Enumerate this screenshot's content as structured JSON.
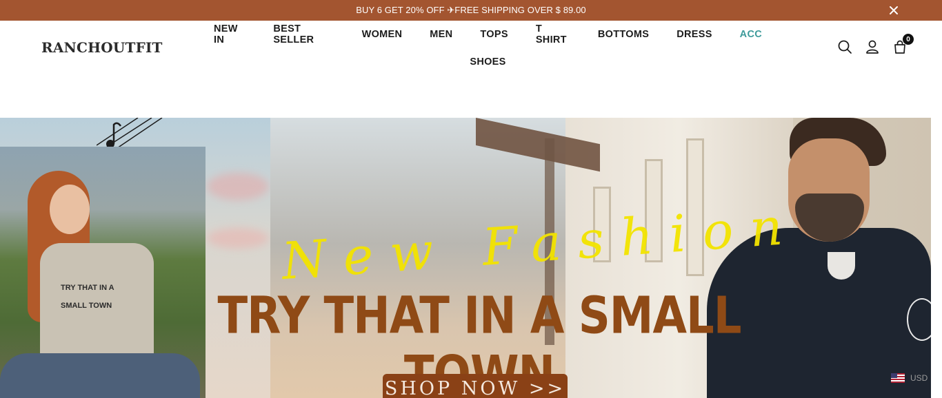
{
  "announcement": {
    "text": "BUY 6 GET 20% OFF ✈FREE SHIPPING OVER $ 89.00",
    "close_icon": "close-icon"
  },
  "header": {
    "logo": "RANCHOUTFIT",
    "nav": {
      "row1": [
        "NEW IN",
        "BEST SELLER",
        "WOMEN",
        "MEN",
        "TOPS",
        "T SHIRT",
        "BOTTOMS",
        "DRESS",
        "ACC"
      ],
      "row2": [
        "SHOES"
      ],
      "active_item": "ACC",
      "accent_color": "#3d9a9a"
    },
    "icons": [
      "search-icon",
      "account-icon",
      "cart-icon"
    ],
    "cart_count": "0"
  },
  "hero": {
    "script_text": "New Fashion",
    "headline": "TRY THAT IN A SMALL TOWN",
    "shirt_text_line1": "TRY THAT IN A",
    "shirt_text_line2": "SMALL TOWN",
    "cta_label": "SHOP NOW >>",
    "headline_color": "#8f4a16",
    "script_color": "#f3e400",
    "cta_color": "#8a4116"
  },
  "currency": {
    "code": "USD",
    "flag_icon": "us-flag-icon"
  },
  "colors": {
    "announce_bg": "#a35530"
  }
}
